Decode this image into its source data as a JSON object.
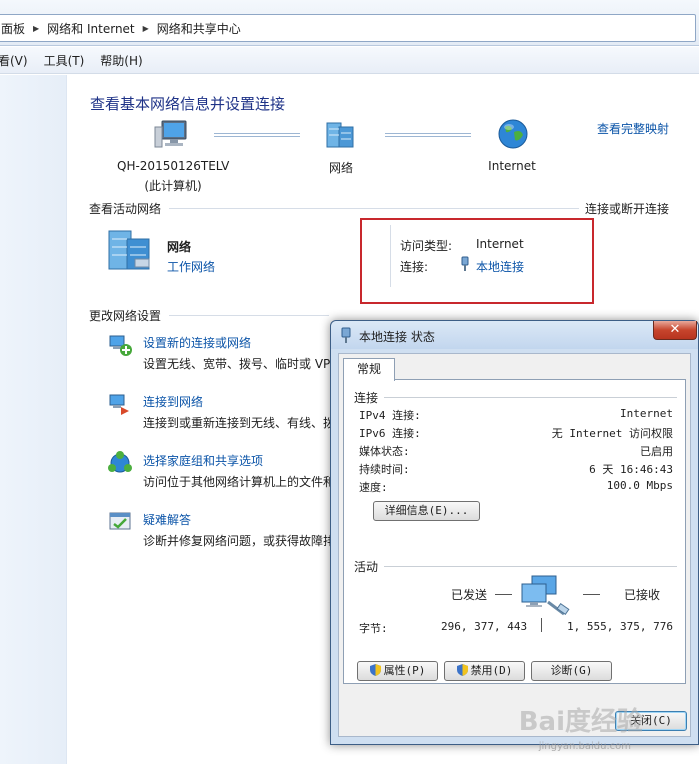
{
  "breadcrumb": {
    "items": [
      "面板",
      "网络和 Internet",
      "网络和共享中心"
    ]
  },
  "menubar": {
    "items": [
      "看(V)",
      "工具(T)",
      "帮助(H)"
    ]
  },
  "main": {
    "title": "查看基本网络信息并设置连接",
    "full_map_link": "查看完整映射",
    "map": {
      "computer_name": "QH-20150126TELV",
      "computer_note": "(此计算机)",
      "network_label": "网络",
      "internet_label": "Internet"
    },
    "active_networks": {
      "heading": "查看活动网络",
      "connect_link": "连接或断开连接",
      "network_name": "网络",
      "network_type": "工作网络",
      "access_type_label": "访问类型:",
      "access_type_value": "Internet",
      "connection_label": "连接:",
      "connection_value": "本地连接"
    },
    "change_settings": {
      "heading": "更改网络设置",
      "tasks": [
        {
          "title": "设置新的连接或网络",
          "desc": "设置无线、宽带、拨号、临时或 VP"
        },
        {
          "title": "连接到网络",
          "desc": "连接到或重新连接到无线、有线、拨"
        },
        {
          "title": "选择家庭组和共享选项",
          "desc": "访问位于其他网络计算机上的文件和"
        },
        {
          "title": "疑难解答",
          "desc": "诊断并修复网络问题，或获得故障排"
        }
      ]
    }
  },
  "dialog": {
    "title": "本地连接 状态",
    "close_label": "✕",
    "tab_label": "常规",
    "connection_group": "连接",
    "rows": [
      {
        "label": "IPv4 连接:",
        "value": "Internet"
      },
      {
        "label": "IPv6 连接:",
        "value": "无 Internet 访问权限"
      },
      {
        "label": "媒体状态:",
        "value": "已启用"
      },
      {
        "label": "持续时间:",
        "value": "6 天 16:46:43"
      },
      {
        "label": "速度:",
        "value": "100.0 Mbps"
      }
    ],
    "details_button": "详细信息(E)...",
    "activity_group": "活动",
    "sent_label": "已发送",
    "received_label": "已接收",
    "bytes_label": "字节:",
    "bytes_sent": "296, 377, 443",
    "bytes_received": "1, 555, 375, 776",
    "properties_button": "属性(P)",
    "disable_button": "禁用(D)",
    "diagnose_button": "诊断(G)",
    "close_button": "关闭(C)"
  },
  "watermark": {
    "text": "Bai度经验",
    "url": "jingyan.baidu.com"
  }
}
